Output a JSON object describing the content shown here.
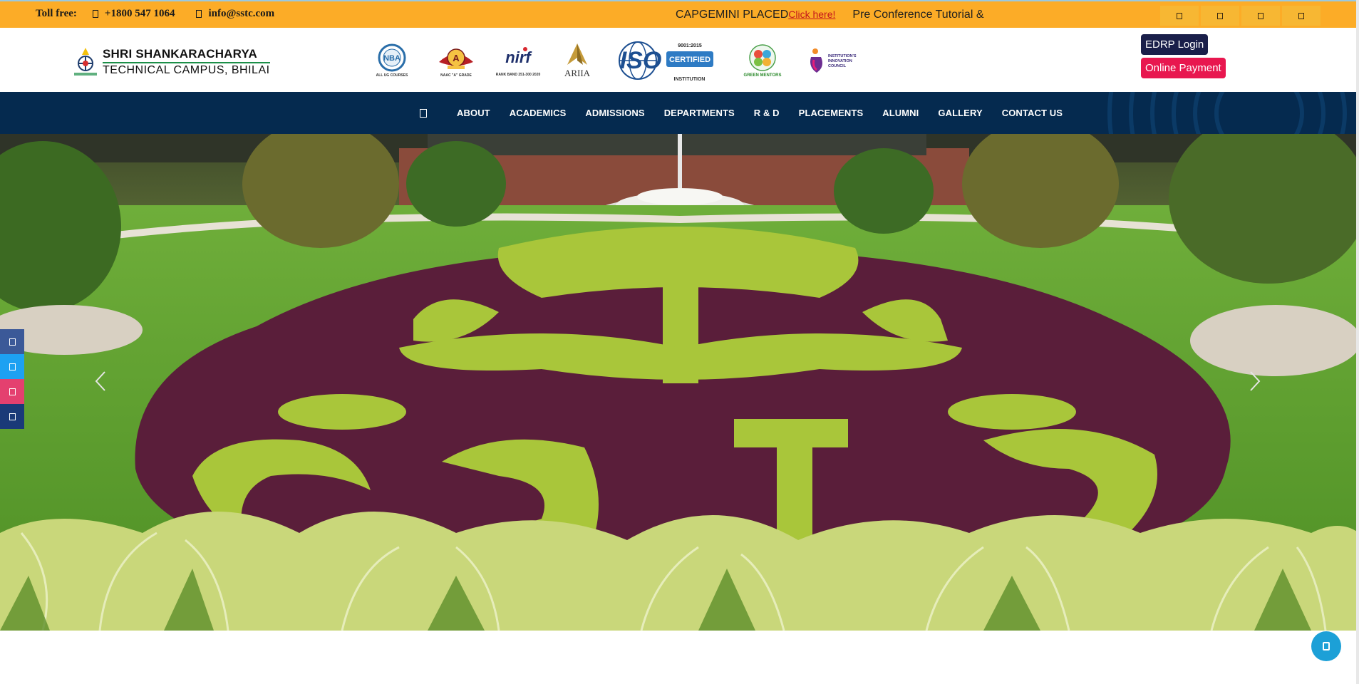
{
  "topbar": {
    "toll_free_label": "Toll free:",
    "phone": "+1800 547 1064",
    "email": "info@sstc.com",
    "marquee_text": "CAPGEMINI PLACED",
    "marquee_link": "Click here!",
    "marquee_text2": "Pre Conference Tutorial &",
    "background": "#fcac27",
    "social_icons": [
      "facebook-icon",
      "twitter-icon",
      "instagram-icon",
      "linkedin-icon"
    ]
  },
  "header": {
    "logo_line1": "SHRI SHANKARACHARYA",
    "logo_line2": "TECHNICAL CAMPUS, BHILAI",
    "accreditations": [
      {
        "name": "nba-logo",
        "caption": "ALL UG COURSES"
      },
      {
        "name": "naac-logo",
        "caption": "NAAC \"A\" GRADE"
      },
      {
        "name": "nirf-logo",
        "caption": "RANK BAND 251-300 2020"
      },
      {
        "name": "ariia-logo",
        "caption": "ARIIA"
      },
      {
        "name": "iso-logo",
        "caption": "INSTITUTION"
      },
      {
        "name": "green-mentors-logo",
        "caption": "GREEN MENTORS"
      },
      {
        "name": "iic-logo",
        "caption": "INSTITUTION'S INNOVATION COUNCIL"
      }
    ],
    "edrp_login": "EDRP Login",
    "online_payment": "Online Payment",
    "edrp_color": "#1a1f4a",
    "payment_color": "#e8174f"
  },
  "nav": {
    "background": "#052a4f",
    "items": [
      "ABOUT",
      "ACADEMICS",
      "ADMISSIONS",
      "DEPARTMENTS",
      "R & D",
      "PLACEMENTS",
      "ALUMNI",
      "GALLERY",
      "CONTACT US"
    ]
  },
  "side_social": [
    {
      "icon": "facebook-icon",
      "color": "#3b5998"
    },
    {
      "icon": "twitter-icon",
      "color": "#1da1f2"
    },
    {
      "icon": "instagram-icon",
      "color": "#e4406f"
    },
    {
      "icon": "linkedin-icon",
      "color": "#1a3a78"
    }
  ],
  "chat_icon": "chat-icon"
}
